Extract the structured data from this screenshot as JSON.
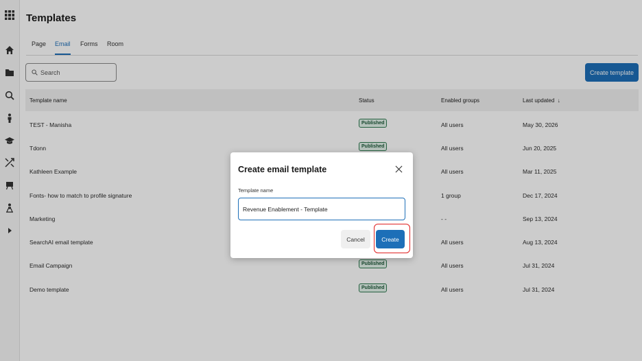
{
  "rail": {
    "icons": [
      "apps-grid-icon",
      "home-icon",
      "folder-icon",
      "search-icon",
      "person-icon",
      "graduation-cap-icon",
      "shuffle-icon",
      "presentation-icon",
      "org-chart-icon",
      "chevron-right-icon"
    ]
  },
  "page": {
    "title": "Templates",
    "tabs": [
      "Page",
      "Email",
      "Forms",
      "Room"
    ],
    "active_tab": "Email",
    "search_placeholder": "Search",
    "create_button": "Create template"
  },
  "table": {
    "headers": [
      "Template name",
      "Status",
      "Enabled groups",
      "Last updated"
    ],
    "sort_indicator": "↓",
    "rows": [
      {
        "name": "TEST - Manisha",
        "status": "Published",
        "groups": "All users",
        "updated": "May 30, 2026"
      },
      {
        "name": "Tdonn",
        "status": "Published",
        "groups": "All users",
        "updated": "Jun 20, 2025"
      },
      {
        "name": "Kathleen Example",
        "status": "",
        "groups": "All users",
        "updated": "Mar 11, 2025"
      },
      {
        "name": "Fonts- how to match to profile signature",
        "status": "",
        "groups": "1 group",
        "updated": "Dec 17, 2024"
      },
      {
        "name": "Marketing",
        "status": "",
        "groups": "- -",
        "updated": "Sep 13, 2024"
      },
      {
        "name": "SearchAI email template",
        "status": "",
        "groups": "All users",
        "updated": "Aug 13, 2024"
      },
      {
        "name": "Email Campaign",
        "status": "Published",
        "groups": "All users",
        "updated": "Jul 31, 2024"
      },
      {
        "name": "Demo template",
        "status": "Published",
        "groups": "All users",
        "updated": "Jul 31, 2024"
      }
    ]
  },
  "modal": {
    "title": "Create email template",
    "field_label": "Template name",
    "field_value": "Revenue Enablement - Template",
    "cancel": "Cancel",
    "create": "Create"
  },
  "colors": {
    "accent": "#1d6fb8",
    "badge_border": "#2f7a50",
    "highlight": "#e02020"
  }
}
